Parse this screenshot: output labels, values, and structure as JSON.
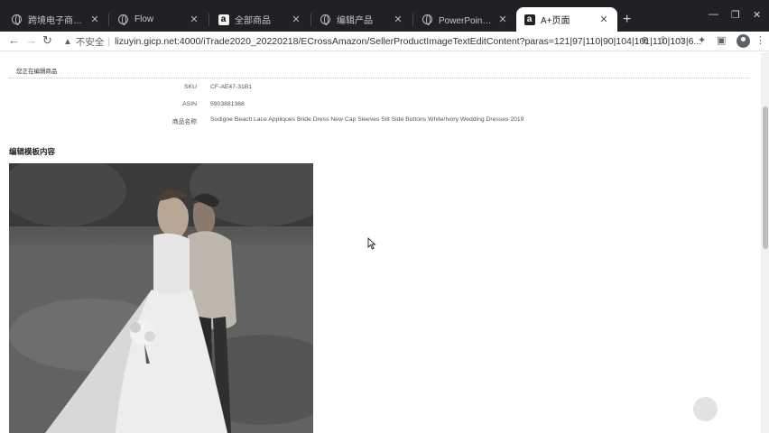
{
  "browser": {
    "tabs": [
      {
        "title": "跨境电子商务实训平...",
        "icon": "globe-icon"
      },
      {
        "title": "Flow",
        "icon": "globe-icon"
      },
      {
        "title": "全部商品",
        "icon": "amazon-icon"
      },
      {
        "title": "编辑产品",
        "icon": "globe-icon"
      },
      {
        "title": "PowerPoint 演示文稿",
        "icon": "globe-icon"
      },
      {
        "title": "A+页面",
        "icon": "amazon-icon",
        "active": true
      }
    ],
    "security_label": "不安全",
    "url": "lizuyin.gicp.net:4000/iTrade2020_20220218/ECrossAmazon/SellerProductImageTextEditContent?paras=121|97|110|90|104|101|110|103|6..."
  },
  "page": {
    "breadcrumb": "您正在编辑商品",
    "fields": [
      {
        "label": "SKU",
        "value": "CF-AE47-31B1"
      },
      {
        "label": "ASIN",
        "value": "5903881368"
      },
      {
        "label": "商品名称",
        "value": "Sodigne Beach Lace Appliques Bride Dress New Cap Sleeves Slit Side Buttons White/Ivory Wedding Dresses 2019"
      }
    ],
    "section_title": "编辑模板内容"
  },
  "colors": {
    "chrome_dark": "#202124",
    "tab_active": "#ffffff",
    "scrollbar_thumb": "#bdbdbd"
  }
}
